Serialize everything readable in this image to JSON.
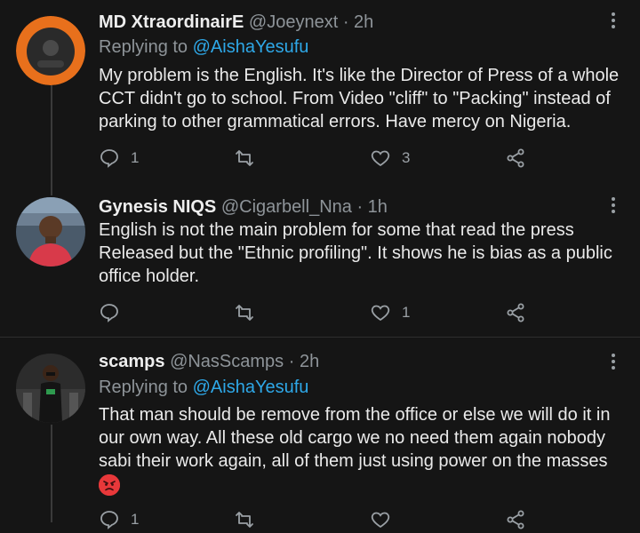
{
  "tweets": [
    {
      "name": "MD XtraordinairE",
      "handle": "@Joeynext",
      "time": "· 2h",
      "replying_prefix": "Replying to",
      "replying_to": "@AishaYesufu",
      "text": "My problem is the English. It's like the Director of Press of a whole CCT didn't go to school. From Video \"cliff\" to \"Packing\" instead of parking to other grammatical errors. Have mercy on Nigeria.",
      "reply_count": "1",
      "retweet_count": "",
      "like_count": "3"
    },
    {
      "name": "Gynesis NIQS",
      "handle": "@Cigarbell_Nna",
      "time": "· 1h",
      "text": "English is not the main problem for some that read the press Released but the \"Ethnic profiling\". It shows he is bias as a public office holder.",
      "reply_count": "",
      "retweet_count": "",
      "like_count": "1"
    },
    {
      "name": "scamps",
      "handle": "@NasScamps",
      "time": "· 2h",
      "replying_prefix": "Replying to",
      "replying_to": "@AishaYesufu",
      "text": "That man should be remove from the office or else we will do it in our own way. All these old cargo we no need them again nobody sabi their work again, all of them just using power on the masses",
      "emoji": "angry-face",
      "reply_count": "1",
      "retweet_count": "",
      "like_count": ""
    }
  ],
  "colors": {
    "background": "#151515",
    "link": "#2ea8e8",
    "muted": "#8e9499"
  }
}
